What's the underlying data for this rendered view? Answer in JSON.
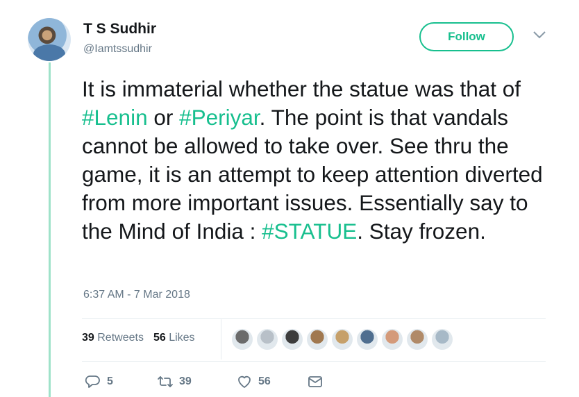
{
  "author": {
    "name": "T S Sudhir",
    "handle": "@Iamtssudhir"
  },
  "follow_button": {
    "label": "Follow"
  },
  "tweet": {
    "text_parts": [
      "It is immaterial whether the statue was that of ",
      "#Lenin",
      " or ",
      "#Periyar",
      ". The point is that vandals cannot be allowed to take over. See thru the game, it is an attempt to keep attention diverted from more important issues. Essentially say to the Mind of India : ",
      "#STATUE",
      ". Stay frozen."
    ],
    "timestamp": "6:37 AM - 7 Mar 2018"
  },
  "stats": {
    "retweets_count": "39",
    "retweets_label": "Retweets",
    "likes_count": "56",
    "likes_label": "Likes"
  },
  "likers": [
    "#6b6b6b",
    "#b8c0c8",
    "#3d3d3d",
    "#a0784f",
    "#c6a06a",
    "#4f6e8f",
    "#d49a7a",
    "#b08a68",
    "#a7b9c7"
  ],
  "actions": {
    "replies": "5",
    "retweets": "39",
    "likes": "56"
  },
  "colors": {
    "accent": "#17bf8e",
    "muted": "#657786",
    "text": "#14171a"
  },
  "icons": [
    "caret-down-icon",
    "reply-icon",
    "retweet-icon",
    "heart-icon",
    "direct-message-icon"
  ]
}
